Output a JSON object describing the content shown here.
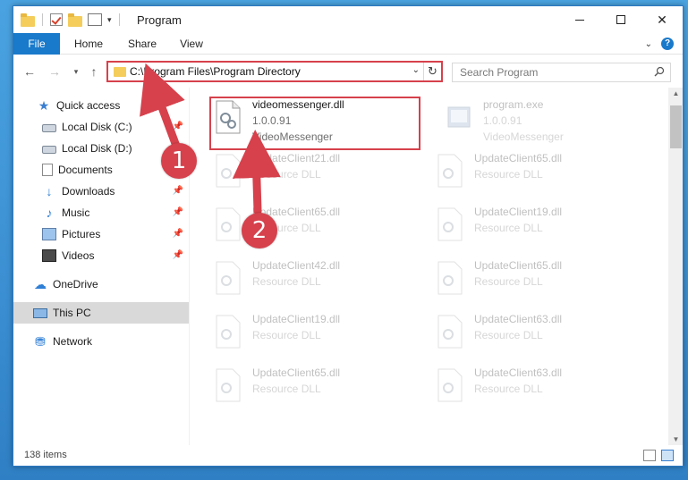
{
  "window": {
    "title": "Program",
    "status": "138 items"
  },
  "ribbon": {
    "tabs": [
      "File",
      "Home",
      "Share",
      "View"
    ]
  },
  "address": {
    "path": "C:\\Program Files\\Program Directory"
  },
  "search": {
    "placeholder": "Search Program"
  },
  "sidebar": {
    "items": [
      {
        "label": "Quick access",
        "icon": "star-icon",
        "pinned": false
      },
      {
        "label": "Local Disk (C:)",
        "icon": "drive-icon",
        "pinned": true
      },
      {
        "label": "Local Disk (D:)",
        "icon": "drive-icon",
        "pinned": false
      },
      {
        "label": "Documents",
        "icon": "documents-icon",
        "pinned": true
      },
      {
        "label": "Downloads",
        "icon": "downloads-icon",
        "pinned": true
      },
      {
        "label": "Music",
        "icon": "music-icon",
        "pinned": true
      },
      {
        "label": "Pictures",
        "icon": "pictures-icon",
        "pinned": true
      },
      {
        "label": "Videos",
        "icon": "videos-icon",
        "pinned": true
      },
      {
        "label": "OneDrive",
        "icon": "onedrive-icon",
        "pinned": false
      },
      {
        "label": "This PC",
        "icon": "pc-icon",
        "pinned": false,
        "selected": true
      },
      {
        "label": "Network",
        "icon": "network-icon",
        "pinned": false
      }
    ]
  },
  "files": [
    {
      "name": "videomessenger.dll",
      "line2": "1.0.0.91",
      "line3": "VideoMessenger",
      "highlighted": true
    },
    {
      "name": "program.exe",
      "line2": "1.0.0.91",
      "line3": "VideoMessenger",
      "faded": true
    },
    {
      "name": "UpdateClient21.dll",
      "line2": "Resource DLL",
      "line3": "",
      "faded": true
    },
    {
      "name": "UpdateClient65.dll",
      "line2": "Resource DLL",
      "line3": "",
      "faded": true
    },
    {
      "name": "UpdateClient65.dll",
      "line2": "Resource DLL",
      "line3": "",
      "faded": true
    },
    {
      "name": "UpdateClient19.dll",
      "line2": "Resource DLL",
      "line3": "",
      "faded": true
    },
    {
      "name": "UpdateClient42.dll",
      "line2": "Resource DLL",
      "line3": "",
      "faded": true
    },
    {
      "name": "UpdateClient65.dll",
      "line2": "Resource DLL",
      "line3": "",
      "faded": true
    },
    {
      "name": "UpdateClient19.dll",
      "line2": "Resource DLL",
      "line3": "",
      "faded": true
    },
    {
      "name": "UpdateClient63.dll",
      "line2": "Resource DLL",
      "line3": "",
      "faded": true
    },
    {
      "name": "UpdateClient65.dll",
      "line2": "Resource DLL",
      "line3": "",
      "faded": true
    },
    {
      "name": "UpdateClient63.dll",
      "line2": "Resource DLL",
      "line3": "",
      "faded": true
    }
  ],
  "annotations": {
    "badge1": "1",
    "badge2": "2"
  },
  "colors": {
    "accent": "#1979ca",
    "highlight": "#d6414c"
  }
}
